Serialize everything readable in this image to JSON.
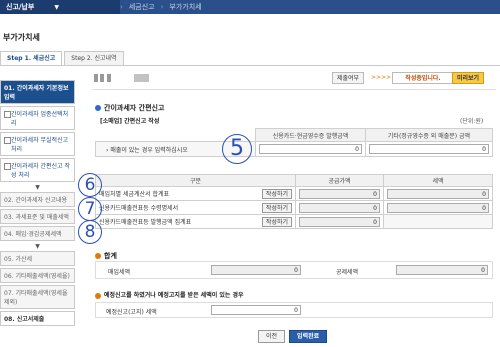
{
  "topbar": {
    "title": "신고/납부",
    "crumb2": "세금신고",
    "crumb3": "부가가치세"
  },
  "page_title": "부가가치세",
  "tabs": [
    {
      "label": "Step 1. 세금신고"
    },
    {
      "label": "Step 2. 신고내역"
    }
  ],
  "sidebar": {
    "item1": "01. 간이과세자 기본정보 입력",
    "sub1": "간이과세자 업종선택처리",
    "sub2": "간이과세자 무실적신고 처리",
    "sub3": "간이과세자 간편신고 작성 처리",
    "item2": "02. 간이과세자 신고내용",
    "item3": "03. 과세표준 및 매출세액",
    "item4": "04. 매입·경감공제세액",
    "item5": "05. 가산세",
    "item6": "06. 기타매출세액(영세율)",
    "item7": "07. 기타매출세액(영세율제외)",
    "item8": "08. 신고서제출"
  },
  "status": {
    "submit_label": "제출여부",
    "arrow": ">>>>",
    "status_text": "작성중입니다.",
    "preview_label": "미리보기"
  },
  "section_main": "간이과세자 간편신고",
  "section_sales": "[소매업] 간편신고 작성",
  "unit": "(단위:원)",
  "sales_table": {
    "col1": "신용카드·현금영수증 발행금액",
    "col2": "기타(정규영수증 외 매출분) 금액",
    "row_label": "매출이 있는 경우 입력하십시오",
    "val1": "0",
    "val2": "0"
  },
  "detail_table": {
    "header": [
      "구분",
      "공급가액",
      "세액"
    ],
    "rows": [
      {
        "label": "매입처별 세금계산서 합계표",
        "button": "작성하기",
        "supply": "0",
        "tax": "0"
      },
      {
        "label": "신용카드매출전표등 수령명세서",
        "button": "작성하기",
        "supply": "0",
        "tax": "0"
      },
      {
        "label": "신용카드매출전표등 발행금액 집계표",
        "button": "작성하기",
        "supply": "0",
        "tax": ""
      }
    ]
  },
  "summary": {
    "title": "합계",
    "purchase_tax_label": "매입세액",
    "purchase_tax": "0",
    "deduct_label": "공제세액",
    "deduct": "0"
  },
  "decision": {
    "title": "예정신고를 하였거나 예정고지를 받은 세액이 있는 경우",
    "label": "예정신고(고지) 세액",
    "value": "0"
  },
  "bottom": {
    "prev": "이전",
    "done": "입력완료"
  },
  "markers": {
    "m5": "5",
    "m6": "6",
    "m7": "7",
    "m8": "8"
  }
}
